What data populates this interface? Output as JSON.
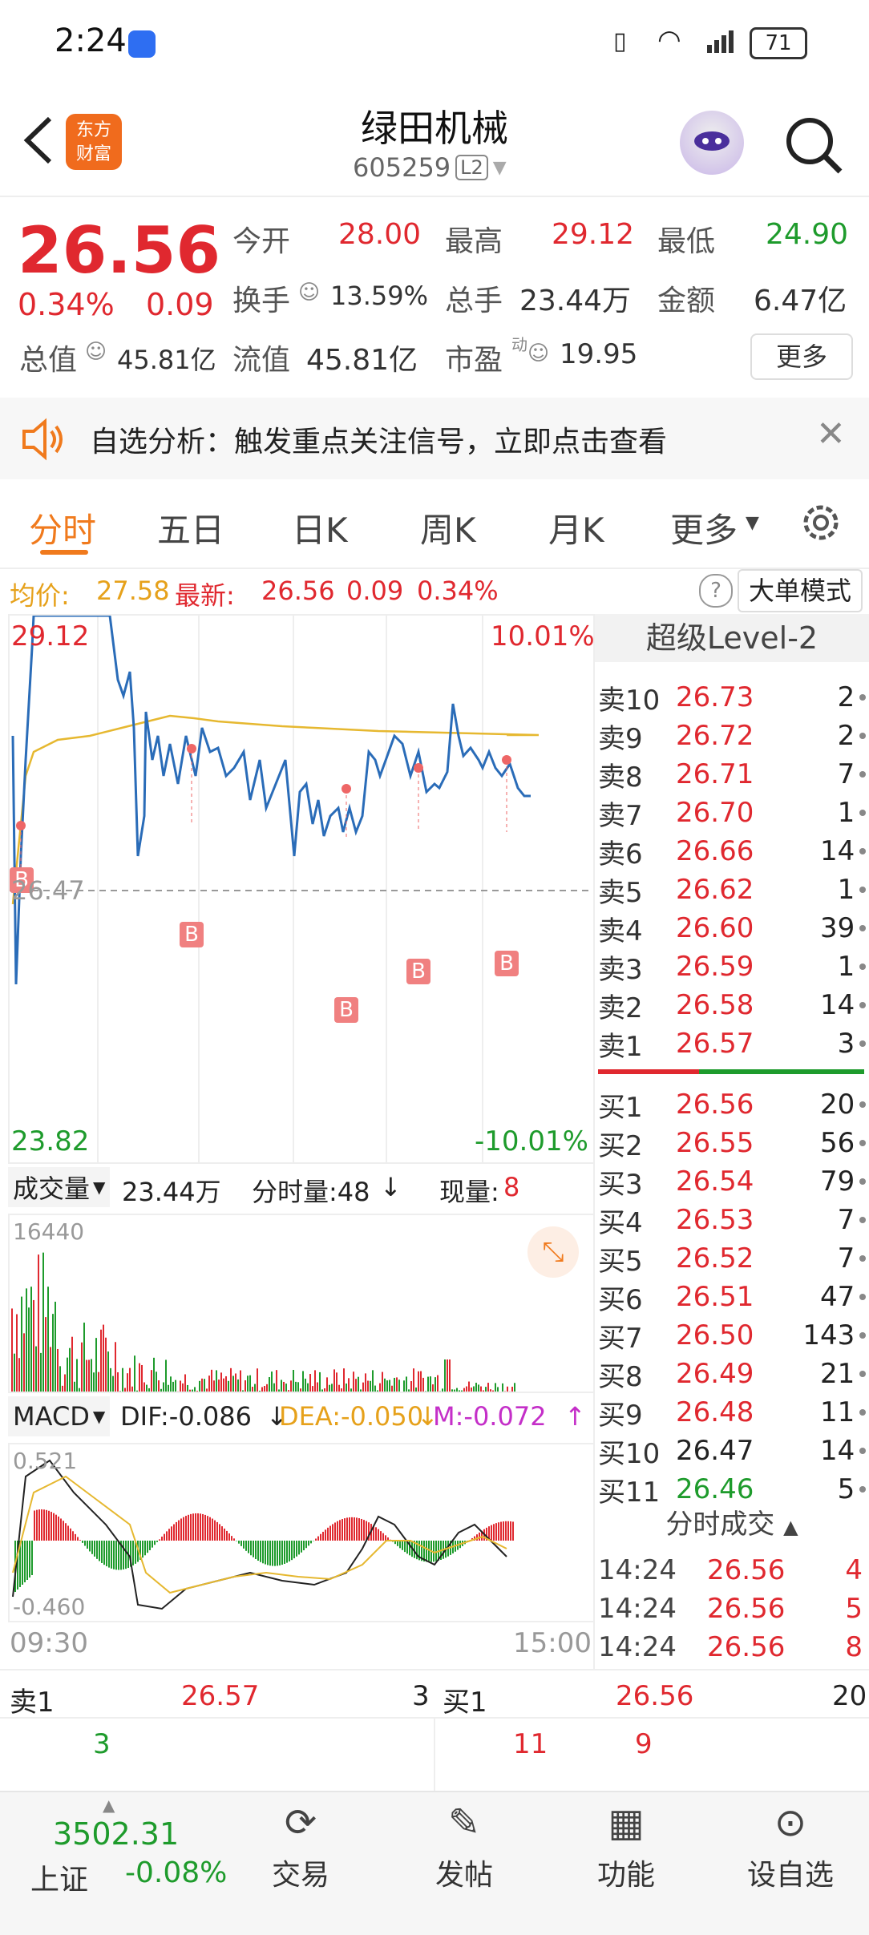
{
  "status_bar": {
    "time": "2:24",
    "battery": "71"
  },
  "header": {
    "title": "绿田机械",
    "code": "605259",
    "badge": "L2"
  },
  "quote": {
    "price": "26.56",
    "change_pct": "0.34%",
    "change": "0.09",
    "open_label": "今开",
    "open": "28.00",
    "high_label": "最高",
    "high": "29.12",
    "low_label": "最低",
    "low": "24.90",
    "turnover_label": "换手",
    "turnover": "13.59%",
    "volume_label": "总手",
    "volume": "23.44万",
    "amount_label": "金额",
    "amount": "6.47亿",
    "mktcap_label": "总值",
    "mktcap": "45.81亿",
    "float_label": "流值",
    "float": "45.81亿",
    "pe_label": "市盈",
    "pe_sup": "动",
    "pe": "19.95",
    "more_button": "更多"
  },
  "notice": {
    "text": "自选分析：触发重点关注信号，立即点击查看"
  },
  "tabs": [
    "分时",
    "五日",
    "日K",
    "周K",
    "月K",
    "更多"
  ],
  "chart_info": {
    "avg_label": "均价:",
    "avg": "27.58",
    "latest_label": "最新:",
    "latest": "26.56",
    "chg": "0.09",
    "pct": "0.34%",
    "big_order": "大单模式"
  },
  "price_axis": {
    "high": "29.12",
    "high_pct": "10.01%",
    "mid": "26.47",
    "low": "23.82",
    "low_pct": "-10.01%"
  },
  "volume_bar": {
    "label": "成交量",
    "total": "23.44万",
    "period_label": "分时量:48",
    "now_label": "现量:",
    "now": "8",
    "max": "16440"
  },
  "macd": {
    "label": "MACD",
    "dif": "DIF:-0.086",
    "dea": "DEA:-0.050",
    "m": "M:-0.072",
    "top": "0.521",
    "bottom": "-0.460"
  },
  "time_axis": {
    "start": "09:30",
    "end": "15:00"
  },
  "level2": {
    "title": "超级Level-2",
    "asks": [
      {
        "label": "卖10",
        "price": "26.73",
        "vol": "2"
      },
      {
        "label": "卖9",
        "price": "26.72",
        "vol": "2"
      },
      {
        "label": "卖8",
        "price": "26.71",
        "vol": "7"
      },
      {
        "label": "卖7",
        "price": "26.70",
        "vol": "1"
      },
      {
        "label": "卖6",
        "price": "26.66",
        "vol": "14"
      },
      {
        "label": "卖5",
        "price": "26.62",
        "vol": "1"
      },
      {
        "label": "卖4",
        "price": "26.60",
        "vol": "39"
      },
      {
        "label": "卖3",
        "price": "26.59",
        "vol": "1"
      },
      {
        "label": "卖2",
        "price": "26.58",
        "vol": "14"
      },
      {
        "label": "卖1",
        "price": "26.57",
        "vol": "3"
      }
    ],
    "bids": [
      {
        "label": "买1",
        "price": "26.56",
        "vol": "20"
      },
      {
        "label": "买2",
        "price": "26.55",
        "vol": "56"
      },
      {
        "label": "买3",
        "price": "26.54",
        "vol": "79"
      },
      {
        "label": "买4",
        "price": "26.53",
        "vol": "7"
      },
      {
        "label": "买5",
        "price": "26.52",
        "vol": "7"
      },
      {
        "label": "买6",
        "price": "26.51",
        "vol": "47"
      },
      {
        "label": "买7",
        "price": "26.50",
        "vol": "143"
      },
      {
        "label": "买8",
        "price": "26.49",
        "vol": "21"
      },
      {
        "label": "买9",
        "price": "26.48",
        "vol": "11"
      },
      {
        "label": "买10",
        "price": "26.47",
        "vol": "14"
      },
      {
        "label": "买11",
        "price": "26.46",
        "vol": "5"
      }
    ],
    "trades_title": "分时成交",
    "trades": [
      {
        "time": "14:24",
        "price": "26.56",
        "vol": "4"
      },
      {
        "time": "14:24",
        "price": "26.56",
        "vol": "5"
      },
      {
        "time": "14:24",
        "price": "26.56",
        "vol": "8"
      }
    ]
  },
  "bottom_quote": {
    "ask_label": "卖1",
    "ask_price": "26.57",
    "ask_vol": "3",
    "bid_label": "买1",
    "bid_price": "26.56",
    "bid_vol": "20",
    "ask_queue": "3",
    "bid_queue1": "11",
    "bid_queue2": "9"
  },
  "bottom_nav": {
    "index_value": "3502.31",
    "index_name": "上证",
    "index_chg": "-0.08%",
    "items": [
      "交易",
      "发帖",
      "功能",
      "设自选"
    ]
  },
  "colors": {
    "red": "#e0282f",
    "green": "#1e9b2c",
    "accent": "#f07a1d"
  }
}
